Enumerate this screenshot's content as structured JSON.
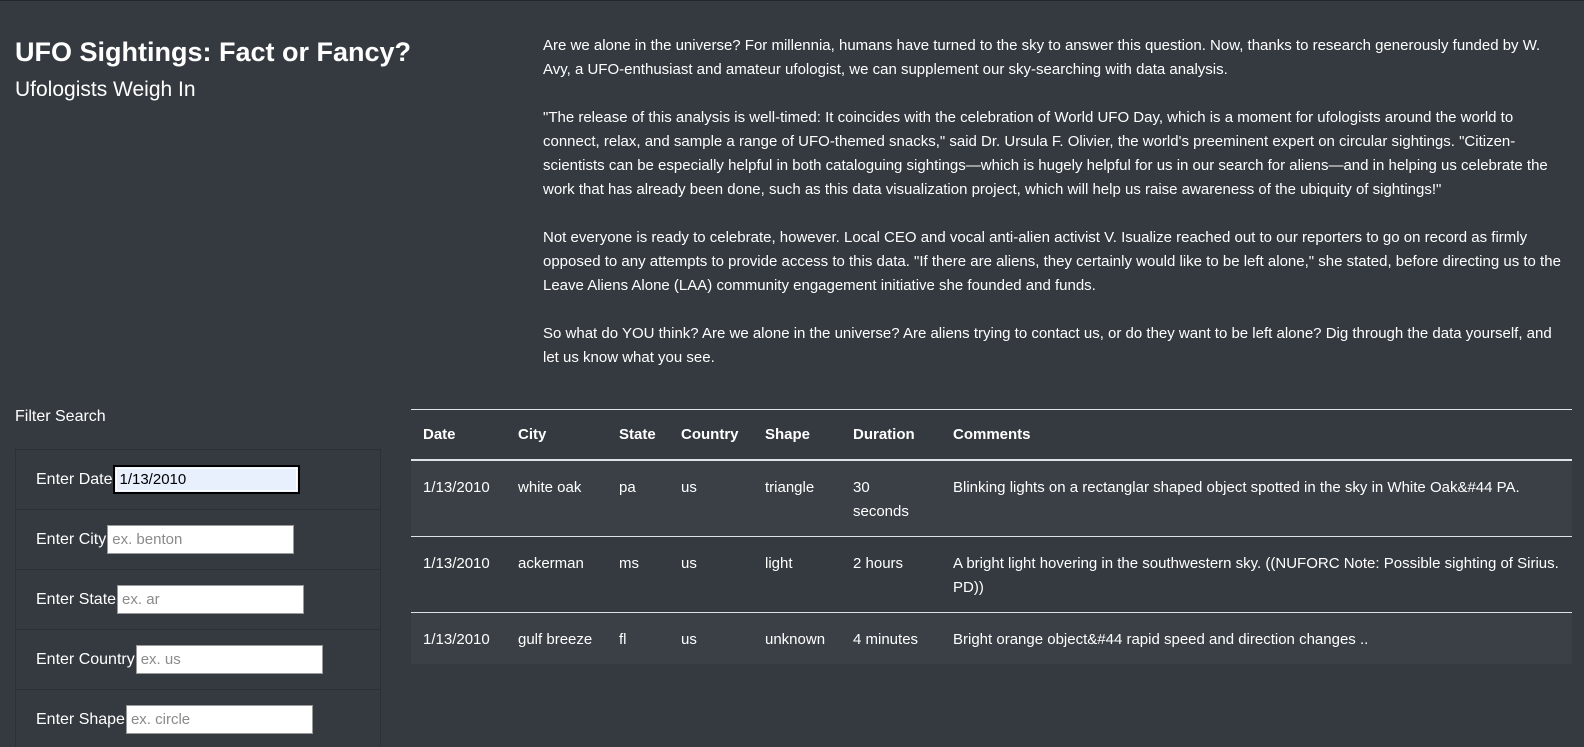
{
  "header": {
    "title": "UFO Sightings: Fact or Fancy?",
    "subtitle": "Ufologists Weigh In"
  },
  "article": {
    "paragraphs": [
      "Are we alone in the universe? For millennia, humans have turned to the sky to answer this question. Now, thanks to research generously funded by W. Avy, a UFO-enthusiast and amateur ufologist, we can supplement our sky-searching with data analysis.",
      "\"The release of this analysis is well-timed: It coincides with the celebration of World UFO Day, which is a moment for ufologists around the world to connect, relax, and sample a range of UFO-themed snacks,\" said Dr. Ursula F. Olivier, the world's preeminent expert on circular sightings. \"Citizen-scientists can be especially helpful in both cataloguing sightings—which is hugely helpful for us in our search for aliens—and in helping us celebrate the work that has already been done, such as this data visualization project, which will help us raise awareness of the ubiquity of sightings!\"",
      "Not everyone is ready to celebrate, however. Local CEO and vocal anti-alien activist V. Isualize reached out to our reporters to go on record as firmly opposed to any attempts to provide access to this data. \"If there are aliens, they certainly would like to be left alone,\" she stated, before directing us to the Leave Aliens Alone (LAA) community engagement initiative she founded and funds.",
      "So what do YOU think? Are we alone in the universe? Are aliens trying to contact us, or do they want to be left alone? Dig through the data yourself, and let us know what you see."
    ]
  },
  "filters": {
    "title": "Filter Search",
    "date": {
      "label": "Enter Date",
      "value": "1/13/2010",
      "placeholder": ""
    },
    "city": {
      "label": "Enter City",
      "value": "",
      "placeholder": "ex. benton"
    },
    "state": {
      "label": "Enter State",
      "value": "",
      "placeholder": "ex. ar"
    },
    "country": {
      "label": "Enter Country",
      "value": "",
      "placeholder": "ex. us"
    },
    "shape": {
      "label": "Enter Shape",
      "value": "",
      "placeholder": "ex. circle"
    }
  },
  "table": {
    "headers": [
      "Date",
      "City",
      "State",
      "Country",
      "Shape",
      "Duration",
      "Comments"
    ],
    "rows": [
      [
        "1/13/2010",
        "white oak",
        "pa",
        "us",
        "triangle",
        "30 seconds",
        "Blinking lights on a rectanglar shaped object spotted in the sky in White Oak&#44 PA."
      ],
      [
        "1/13/2010",
        "ackerman",
        "ms",
        "us",
        "light",
        "2 hours",
        "A bright light hovering in the southwestern sky. ((NUFORC Note: Possible sighting of Sirius. PD))"
      ],
      [
        "1/13/2010",
        "gulf breeze",
        "fl",
        "us",
        "unknown",
        "4 minutes",
        "Bright orange object&#44 rapid speed and direction changes .."
      ]
    ]
  },
  "colors": {
    "background": "#343a40",
    "text": "#ffffff"
  }
}
